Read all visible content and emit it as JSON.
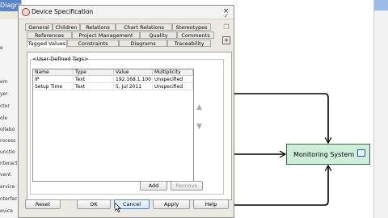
{
  "app": {
    "title": "Diagra",
    "sidebar_items": [
      "e",
      "em",
      "yer",
      "ctor",
      "ole",
      "ollabo",
      "rocess",
      "unctio",
      "nteract",
      "vent",
      "ervice",
      "nterfac",
      "evice"
    ]
  },
  "diagram": {
    "node_label": "Monitoring System",
    "colors": {
      "node_fill": "#cfeeda",
      "node_border": "#3b6d4a",
      "arrow": "#000000"
    }
  },
  "dialog": {
    "title": "Device Specification",
    "close_label": "×",
    "tabs_row1": [
      "General",
      "Children",
      "Relations",
      "Chart Relations",
      "Stereotypes"
    ],
    "tabs_row2": [
      "References",
      "Project Management",
      "Quality",
      "Comments"
    ],
    "tabs_row3": [
      "Tagged Values",
      "Constraints",
      "Diagrams",
      "Traceability"
    ],
    "active_tab": "Tagged Values",
    "group_label": "<User-Defined Tags>",
    "table": {
      "columns": [
        "Name",
        "Type",
        "Value",
        "Multiplicity"
      ],
      "rows": [
        {
          "name": "IP",
          "type": "Text",
          "value": "192.168.1.100",
          "multiplicity": "Unspecified"
        },
        {
          "name": "Setup Time",
          "type": "Text",
          "value": "5, Jul 2011",
          "multiplicity": "Unspecified"
        }
      ]
    },
    "add_label": "Add",
    "remove_label": "Remove",
    "buttons": {
      "reset": "Reset",
      "ok": "OK",
      "cancel": "Cancel",
      "apply": "Apply",
      "help": "Help"
    },
    "icons": [
      "checkmark-icon",
      "copy-icon",
      "expand-icon",
      "move-up-icon",
      "move-down-icon"
    ]
  }
}
